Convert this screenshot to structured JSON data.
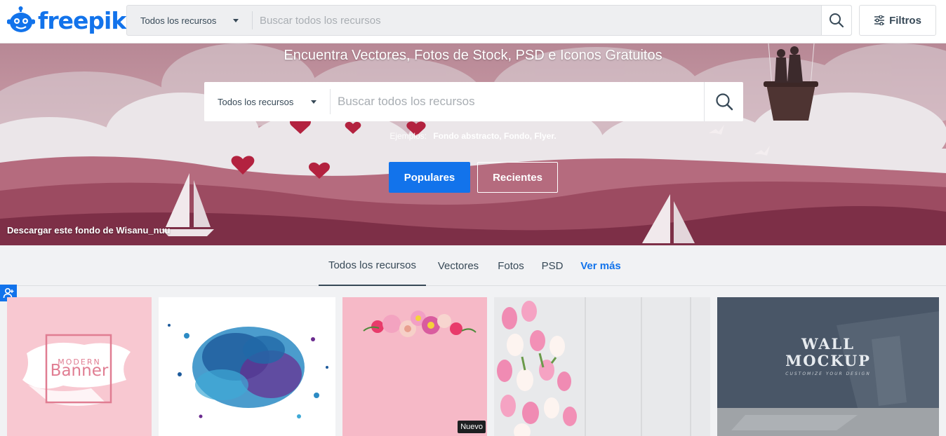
{
  "header": {
    "logo_text": "freepik",
    "search_category": "Todos los recursos",
    "search_placeholder": "Buscar todos los recursos",
    "filters_label": "Filtros"
  },
  "hero": {
    "title": "Encuentra Vectores, Fotos de Stock, PSD e Iconos Gratuitos",
    "search_category": "Todos los recursos",
    "search_placeholder": "Buscar todos los recursos",
    "examples_label": "Ejemplos:",
    "examples_links": "Fondo abstracto, Fondo, Flyer.",
    "popular_label": "Populares",
    "recent_label": "Recientes",
    "credit": "Descargar este fondo de Wisanu_nuu"
  },
  "tabs": [
    {
      "label": "Todos los recursos",
      "active": true
    },
    {
      "label": "Vectores",
      "active": false
    },
    {
      "label": "Fotos",
      "active": false
    },
    {
      "label": "PSD",
      "active": false
    },
    {
      "label": "Ver más",
      "active": false
    }
  ],
  "cards": [
    {
      "name": "modern-banner",
      "line1": "MODERN",
      "line2": "Banner"
    },
    {
      "name": "watercolor-splash"
    },
    {
      "name": "pink-flowers",
      "badge": "Nuevo"
    },
    {
      "name": "pink-tulips"
    },
    {
      "name": "wall-mockup",
      "line1": "WALL",
      "line2": "MOCKUP",
      "line3": "CUSTOMIZE YOUR DESIGN"
    }
  ],
  "colors": {
    "brand": "#1273eb",
    "text": "#374957",
    "hero": "#b06d80"
  }
}
